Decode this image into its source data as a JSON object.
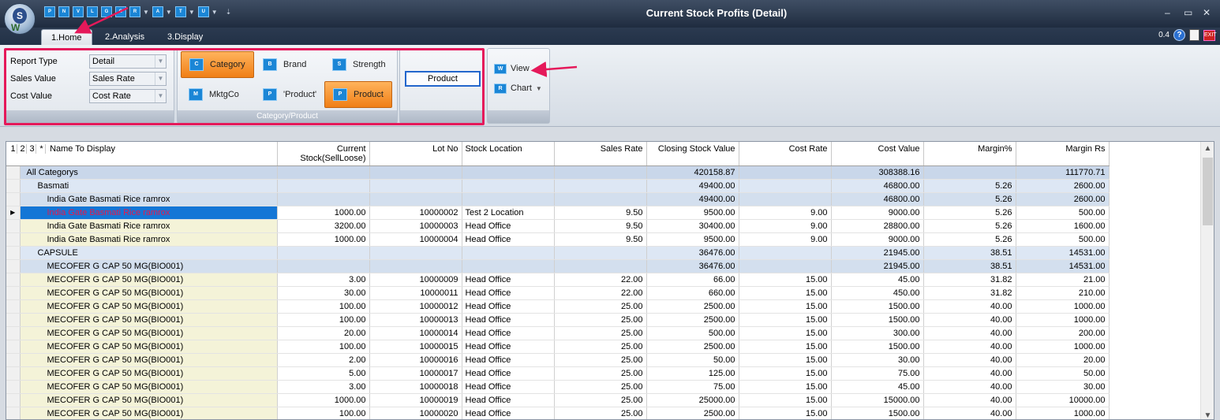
{
  "app": {
    "title": "Current Stock Profits (Detail)",
    "logo_letter": "S",
    "logo_sub": "W"
  },
  "quick_access": [
    "P",
    "N",
    "V",
    "L",
    "G",
    "O",
    "R",
    "A",
    "T",
    "U"
  ],
  "window_controls": {
    "minimize": "–",
    "maximize": "▭",
    "close": "✕"
  },
  "tabs": [
    {
      "label": "1.Home",
      "active": true
    },
    {
      "label": "2.Analysis",
      "active": false
    },
    {
      "label": "3.Display",
      "active": false
    }
  ],
  "top_right": {
    "version": "0.4",
    "help": "?",
    "exit": "EXIT"
  },
  "ribbon": {
    "filters": {
      "report_type_label": "Report Type",
      "report_type_value": "Detail",
      "sales_value_label": "Sales Value",
      "sales_value_value": "Sales Rate",
      "cost_value_label": "Cost Value",
      "cost_value_value": "Cost Rate"
    },
    "category_product": {
      "caption": "Category/Product",
      "category": "Category",
      "brand": "Brand",
      "strength": "Strength",
      "mktgco": "MktgCo",
      "product_quoted": "'Product'",
      "product": "Product",
      "category_icon": "C",
      "brand_icon": "B",
      "strength_icon": "S",
      "mktgco_icon": "M",
      "product_quoted_icon": "P",
      "product_icon": "P"
    },
    "product_box": "Product",
    "view": "View",
    "chart": "Chart",
    "view_icon": "W",
    "chart_icon": "R"
  },
  "grid": {
    "level_buttons": [
      "1",
      "2",
      "3",
      "*"
    ],
    "columns": {
      "name": "Name To Display",
      "current_stock_1": "Current",
      "current_stock_2": "Stock(SellLoose)",
      "lot_no": "Lot No",
      "stock_location": "Stock Location",
      "sales_rate": "Sales Rate",
      "closing_value": "Closing Stock Value",
      "cost_rate": "Cost Rate",
      "cost_value": "Cost Value",
      "margin_pct": "Margin%",
      "margin_rs": "Margin Rs"
    },
    "rows": [
      {
        "type": "lvl0",
        "name": "All Categorys",
        "stock": "",
        "lot": "",
        "loc": "",
        "sales": "",
        "closing": "420158.87",
        "cost_rate": "",
        "cost_value": "308388.16",
        "margin_pct": "",
        "margin_rs": "111770.71"
      },
      {
        "type": "lvl1",
        "name": "Basmati",
        "stock": "",
        "lot": "",
        "loc": "",
        "sales": "",
        "closing": "49400.00",
        "cost_rate": "",
        "cost_value": "46800.00",
        "margin_pct": "5.26",
        "margin_rs": "2600.00"
      },
      {
        "type": "lvl2",
        "name": "India Gate Basmati Rice ramrox",
        "stock": "",
        "lot": "",
        "loc": "",
        "sales": "",
        "closing": "49400.00",
        "cost_rate": "",
        "cost_value": "46800.00",
        "margin_pct": "5.26",
        "margin_rs": "2600.00"
      },
      {
        "type": "cur",
        "name": "India Gate Basmati Rice ramrox",
        "stock": "1000.00",
        "lot": "10000002",
        "loc": "Test 2 Location",
        "sales": "9.50",
        "closing": "9500.00",
        "cost_rate": "9.00",
        "cost_value": "9000.00",
        "margin_pct": "5.26",
        "margin_rs": "500.00"
      },
      {
        "type": "det",
        "name": "India Gate Basmati Rice ramrox",
        "stock": "3200.00",
        "lot": "10000003",
        "loc": "Head Office",
        "sales": "9.50",
        "closing": "30400.00",
        "cost_rate": "9.00",
        "cost_value": "28800.00",
        "margin_pct": "5.26",
        "margin_rs": "1600.00"
      },
      {
        "type": "det",
        "name": "India Gate Basmati Rice ramrox",
        "stock": "1000.00",
        "lot": "10000004",
        "loc": "Head Office",
        "sales": "9.50",
        "closing": "9500.00",
        "cost_rate": "9.00",
        "cost_value": "9000.00",
        "margin_pct": "5.26",
        "margin_rs": "500.00"
      },
      {
        "type": "lvl1",
        "name": "CAPSULE",
        "stock": "",
        "lot": "",
        "loc": "",
        "sales": "",
        "closing": "36476.00",
        "cost_rate": "",
        "cost_value": "21945.00",
        "margin_pct": "38.51",
        "margin_rs": "14531.00"
      },
      {
        "type": "lvl2",
        "name": "MECOFER G CAP 50 MG(BIO001)",
        "stock": "",
        "lot": "",
        "loc": "",
        "sales": "",
        "closing": "36476.00",
        "cost_rate": "",
        "cost_value": "21945.00",
        "margin_pct": "38.51",
        "margin_rs": "14531.00"
      },
      {
        "type": "det",
        "name": "MECOFER G CAP 50 MG(BIO001)",
        "stock": "3.00",
        "lot": "10000009",
        "loc": "Head Office",
        "sales": "22.00",
        "closing": "66.00",
        "cost_rate": "15.00",
        "cost_value": "45.00",
        "margin_pct": "31.82",
        "margin_rs": "21.00"
      },
      {
        "type": "det",
        "name": "MECOFER G CAP 50 MG(BIO001)",
        "stock": "30.00",
        "lot": "10000011",
        "loc": "Head Office",
        "sales": "22.00",
        "closing": "660.00",
        "cost_rate": "15.00",
        "cost_value": "450.00",
        "margin_pct": "31.82",
        "margin_rs": "210.00"
      },
      {
        "type": "det",
        "name": "MECOFER G CAP 50 MG(BIO001)",
        "stock": "100.00",
        "lot": "10000012",
        "loc": "Head Office",
        "sales": "25.00",
        "closing": "2500.00",
        "cost_rate": "15.00",
        "cost_value": "1500.00",
        "margin_pct": "40.00",
        "margin_rs": "1000.00"
      },
      {
        "type": "det",
        "name": "MECOFER G CAP 50 MG(BIO001)",
        "stock": "100.00",
        "lot": "10000013",
        "loc": "Head Office",
        "sales": "25.00",
        "closing": "2500.00",
        "cost_rate": "15.00",
        "cost_value": "1500.00",
        "margin_pct": "40.00",
        "margin_rs": "1000.00"
      },
      {
        "type": "det",
        "name": "MECOFER G CAP 50 MG(BIO001)",
        "stock": "20.00",
        "lot": "10000014",
        "loc": "Head Office",
        "sales": "25.00",
        "closing": "500.00",
        "cost_rate": "15.00",
        "cost_value": "300.00",
        "margin_pct": "40.00",
        "margin_rs": "200.00"
      },
      {
        "type": "det",
        "name": "MECOFER G CAP 50 MG(BIO001)",
        "stock": "100.00",
        "lot": "10000015",
        "loc": "Head Office",
        "sales": "25.00",
        "closing": "2500.00",
        "cost_rate": "15.00",
        "cost_value": "1500.00",
        "margin_pct": "40.00",
        "margin_rs": "1000.00"
      },
      {
        "type": "det",
        "name": "MECOFER G CAP 50 MG(BIO001)",
        "stock": "2.00",
        "lot": "10000016",
        "loc": "Head Office",
        "sales": "25.00",
        "closing": "50.00",
        "cost_rate": "15.00",
        "cost_value": "30.00",
        "margin_pct": "40.00",
        "margin_rs": "20.00"
      },
      {
        "type": "det",
        "name": "MECOFER G CAP 50 MG(BIO001)",
        "stock": "5.00",
        "lot": "10000017",
        "loc": "Head Office",
        "sales": "25.00",
        "closing": "125.00",
        "cost_rate": "15.00",
        "cost_value": "75.00",
        "margin_pct": "40.00",
        "margin_rs": "50.00"
      },
      {
        "type": "det",
        "name": "MECOFER G CAP 50 MG(BIO001)",
        "stock": "3.00",
        "lot": "10000018",
        "loc": "Head Office",
        "sales": "25.00",
        "closing": "75.00",
        "cost_rate": "15.00",
        "cost_value": "45.00",
        "margin_pct": "40.00",
        "margin_rs": "30.00"
      },
      {
        "type": "det",
        "name": "MECOFER G CAP 50 MG(BIO001)",
        "stock": "1000.00",
        "lot": "10000019",
        "loc": "Head Office",
        "sales": "25.00",
        "closing": "25000.00",
        "cost_rate": "15.00",
        "cost_value": "15000.00",
        "margin_pct": "40.00",
        "margin_rs": "10000.00"
      },
      {
        "type": "det",
        "name": "MECOFER G CAP 50 MG(BIO001)",
        "stock": "100.00",
        "lot": "10000020",
        "loc": "Head Office",
        "sales": "25.00",
        "closing": "2500.00",
        "cost_rate": "15.00",
        "cost_value": "1500.00",
        "margin_pct": "40.00",
        "margin_rs": "1000.00"
      }
    ]
  },
  "colors": {
    "highlight_border": "#e5195a",
    "selected_row_bg": "#1476d6",
    "selected_row_text": "#e6194b",
    "active_button": "#f07f16"
  }
}
